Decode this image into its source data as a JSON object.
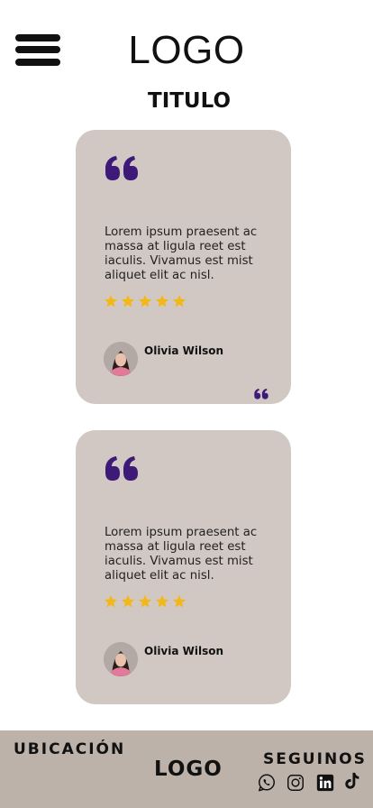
{
  "header": {
    "menu_icon": "hamburger-menu-icon",
    "logo": "LOGO",
    "title": "TITULO"
  },
  "colors": {
    "card_bg": "#d2c8c3",
    "quote_accent": "#3d1a78",
    "star": "#f2b81a",
    "footer_bg": "#bdb2a9"
  },
  "testimonials": [
    {
      "quote": "Lorem ipsum praesent ac massa at ligula reet est iaculis. Vivamus est mist aliquet elit ac nisl.",
      "rating": 5,
      "author": "Olivia Wilson"
    },
    {
      "quote": "Lorem ipsum praesent ac massa at ligula reet est iaculis. Vivamus est mist aliquet elit ac nisl.",
      "rating": 5,
      "author": "Olivia Wilson"
    }
  ],
  "footer": {
    "location_label": "UBICACIÓN",
    "logo": "LOGO",
    "follow_label": "SEGUINOS",
    "social_icons": [
      "whatsapp-icon",
      "instagram-icon",
      "linkedin-icon",
      "tiktok-icon"
    ]
  }
}
